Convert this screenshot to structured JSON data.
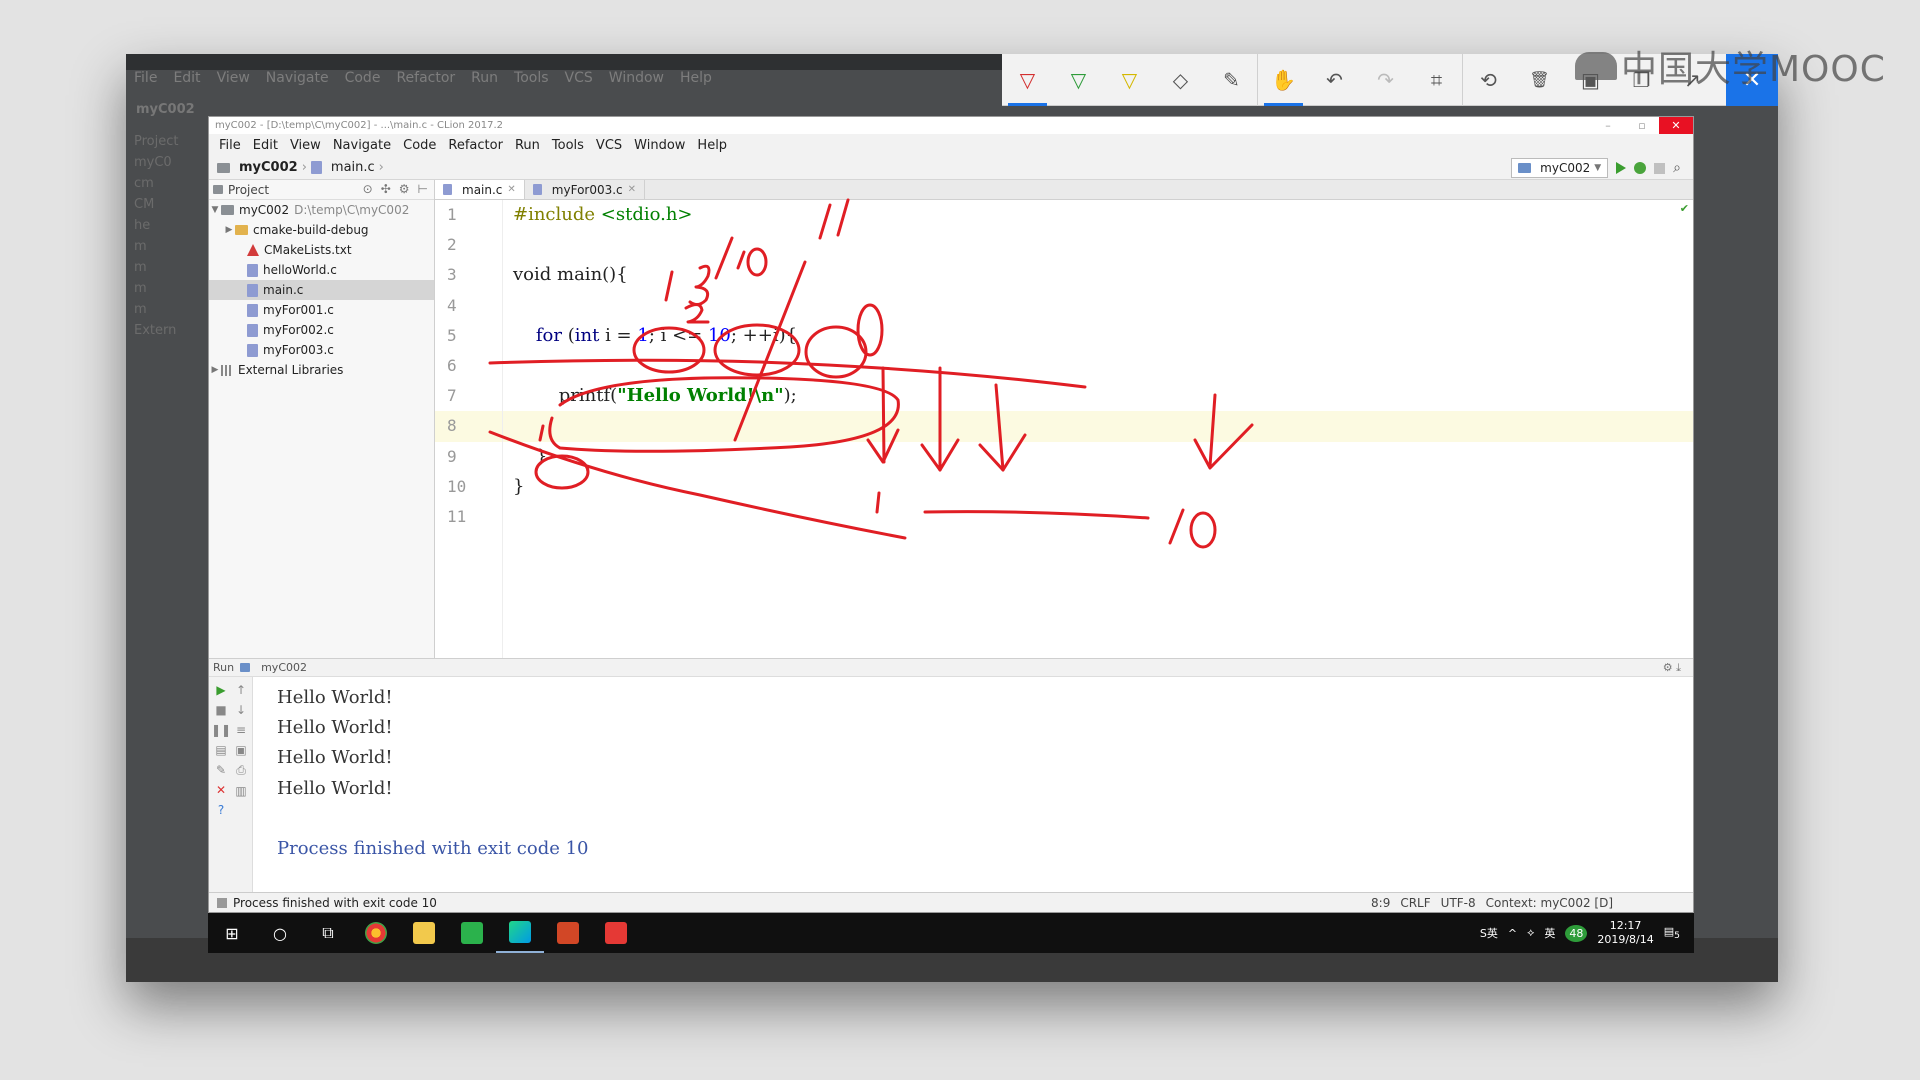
{
  "background_ide": {
    "menu": [
      "File",
      "Edit",
      "View",
      "Navigate",
      "Code",
      "Refactor",
      "Run",
      "Tools",
      "VCS",
      "Window",
      "Help"
    ],
    "crumb": "myC002",
    "left_items": [
      "Project",
      "myC0",
      "cm",
      "CM",
      "he",
      "m",
      "m",
      "m",
      "m",
      "Extern"
    ]
  },
  "annotation_toolbar": {
    "tools": [
      {
        "icon": "red-pen-icon",
        "glyph": "▽"
      },
      {
        "icon": "green-pen-icon",
        "glyph": "▽"
      },
      {
        "icon": "highlighter-icon",
        "glyph": "▽"
      },
      {
        "icon": "eraser-icon",
        "glyph": "◇"
      },
      {
        "icon": "pencil-icon",
        "glyph": "✎"
      },
      {
        "icon": "hand-icon",
        "glyph": "✋"
      },
      {
        "icon": "undo-icon",
        "glyph": "↶"
      },
      {
        "icon": "redo-icon",
        "glyph": "↷"
      },
      {
        "icon": "crop-icon",
        "glyph": "⌗"
      },
      {
        "icon": "history-icon",
        "glyph": "⟲"
      },
      {
        "icon": "trash-icon",
        "glyph": "🗑"
      },
      {
        "icon": "save-icon",
        "glyph": "▣"
      },
      {
        "icon": "copy-icon",
        "glyph": "❐"
      },
      {
        "icon": "share-icon",
        "glyph": "↗"
      }
    ],
    "close_glyph": "✕"
  },
  "watermark": {
    "text": "中国大学MOOC"
  },
  "window": {
    "title": "myC002 - [D:\\temp\\C\\myC002] - ...\\main.c - CLion 2017.2",
    "controls": {
      "minimize": "–",
      "maximize": "▫",
      "close": "✕"
    },
    "menu": [
      "File",
      "Edit",
      "View",
      "Navigate",
      "Code",
      "Refactor",
      "Run",
      "Tools",
      "VCS",
      "Window",
      "Help"
    ],
    "breadcrumb": {
      "project": "myC002",
      "file": "main.c"
    },
    "run_config": "myC002"
  },
  "project_panel": {
    "title": "Project",
    "root": {
      "name": "myC002",
      "path": "D:\\temp\\C\\myC002"
    },
    "items": [
      {
        "name": "cmake-build-debug",
        "type": "folder"
      },
      {
        "name": "CMakeLists.txt",
        "type": "cmake"
      },
      {
        "name": "helloWorld.c",
        "type": "c"
      },
      {
        "name": "main.c",
        "type": "c"
      },
      {
        "name": "myFor001.c",
        "type": "c"
      },
      {
        "name": "myFor002.c",
        "type": "c"
      },
      {
        "name": "myFor003.c",
        "type": "c"
      }
    ],
    "external": "External Libraries"
  },
  "editor": {
    "tabs": [
      {
        "name": "main.c",
        "active": true
      },
      {
        "name": "myFor003.c",
        "active": false
      }
    ],
    "line_numbers": [
      "1",
      "2",
      "3",
      "4",
      "5",
      "6",
      "7",
      "8",
      "9",
      "10",
      "11"
    ],
    "current_line": 8,
    "code": {
      "l1_directive": "#include",
      "l1_header": " <stdio.h>",
      "l3": "void main(){",
      "l5_kw": "for",
      "l5_a": " (",
      "l5_int": "int",
      "l5_b": " i = ",
      "l5_one": "1",
      "l5_c": "; i <= ",
      "l5_ten": "10",
      "l5_d": "; ++i){",
      "l7_fn": "printf(",
      "l7_str": "\"Hello World!\\n\"",
      "l7_end": ");",
      "l9": "}",
      "l10": "}"
    }
  },
  "run_panel": {
    "label": "Run",
    "config": "myC002",
    "output": [
      "Hello World!",
      "Hello World!",
      "Hello World!",
      "Hello World!"
    ],
    "exit_message": "Process finished with exit code 10"
  },
  "status_bar": {
    "message": "Process finished with exit code 10",
    "position": "8:9",
    "line_sep": "CRLF",
    "encoding": "UTF-8",
    "context": "Context: myC002 [D]"
  },
  "taskbar": {
    "time": "12:17",
    "date": "2019/8/14",
    "notifications": "5",
    "battery": "48"
  },
  "ink_annotations": {
    "texts": [
      "11",
      "13/10",
      "2",
      "1",
      "10"
    ]
  }
}
